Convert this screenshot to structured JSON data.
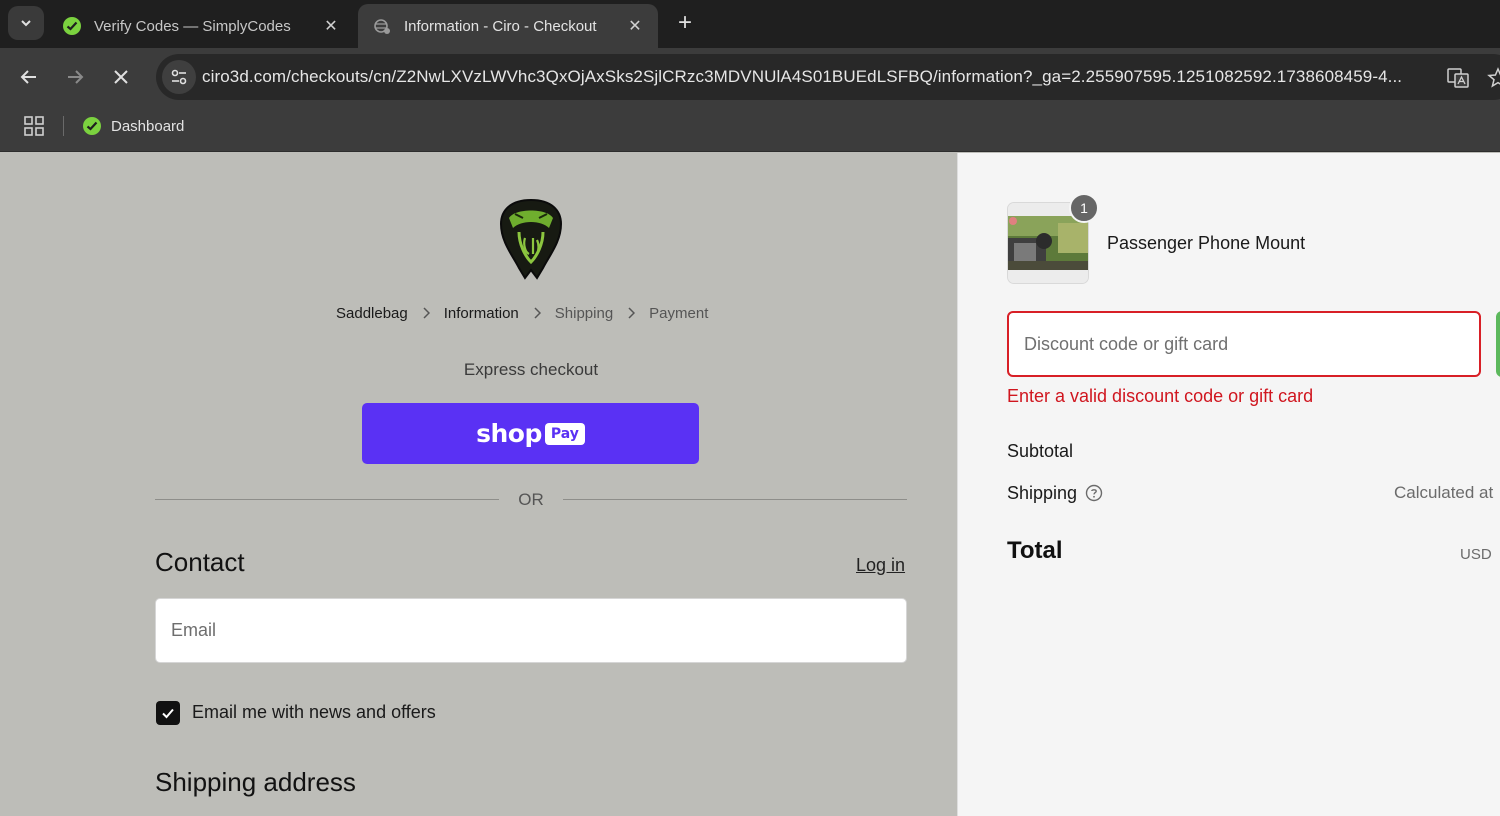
{
  "browser": {
    "tabs": [
      {
        "title": "Verify Codes — SimplyCodes",
        "active": false,
        "favicon": "simplycodes-check-icon"
      },
      {
        "title": "Information - Ciro - Checkout",
        "active": true,
        "favicon": "loading-globe-icon"
      }
    ],
    "url": "ciro3d.com/checkouts/cn/Z2NwLXVzLWVhc3QxOjAxSks2SjlCRzc3MDVNUlA4S01BUEdLSFBQ/information?_ga=2.255907595.1251082592.1738608459-4...",
    "bookmarks": [
      {
        "label": "Dashboard",
        "icon": "simplycodes-check-icon"
      }
    ]
  },
  "checkout": {
    "breadcrumbs": [
      "Saddlebag",
      "Information",
      "Shipping",
      "Payment"
    ],
    "express_label": "Express checkout",
    "shoppay_word": "shop",
    "shoppay_pay": "Pay",
    "or_label": "OR",
    "contact_heading": "Contact",
    "login_link": "Log in",
    "email_placeholder": "Email",
    "newsletter_label": "Email me with news and offers",
    "newsletter_checked": true,
    "shipping_heading": "Shipping address"
  },
  "summary": {
    "product_name": "Passenger Phone Mount",
    "quantity": "1",
    "discount_placeholder": "Discount code or gift card",
    "discount_error": "Enter a valid discount code or gift card",
    "subtotal_label": "Subtotal",
    "shipping_label": "Shipping",
    "shipping_value": "Calculated at",
    "total_label": "Total",
    "currency": "USD"
  },
  "colors": {
    "shoppay": "#5a31f4",
    "error": "#d81f26",
    "page_bg": "#bdbdb8"
  }
}
